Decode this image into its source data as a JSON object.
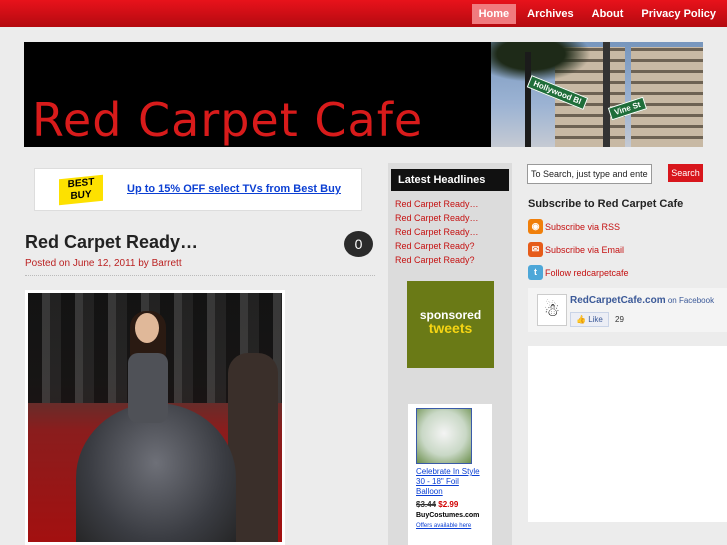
{
  "nav": {
    "items": [
      {
        "label": "Home",
        "active": true
      },
      {
        "label": "Archives",
        "active": false
      },
      {
        "label": "About",
        "active": false
      },
      {
        "label": "Privacy Policy",
        "active": false
      }
    ]
  },
  "header": {
    "site_title": "Red Carpet Cafe",
    "street_sign_1": "Hollywood Bl",
    "street_sign_2": "Vine St"
  },
  "ad": {
    "brand_line1": "BEST",
    "brand_line2": "BUY",
    "link_text": "Up to 15% OFF select TVs from Best Buy"
  },
  "post": {
    "title": "Red Carpet Ready…",
    "comment_count": "0",
    "meta_prefix": "Posted on ",
    "date": "June 12, 2011",
    "meta_by": " by ",
    "author": "Barrett"
  },
  "headlines": {
    "title": "Latest Headlines",
    "items": [
      "Red Carpet Ready…",
      "Red Carpet Ready…",
      "Red Carpet Ready…",
      "Red Carpet Ready?",
      "Red Carpet Ready?"
    ]
  },
  "sponsored": {
    "line1": "sponsored",
    "line2": "tweets"
  },
  "product_ad": {
    "link": "Celebrate In Style 30 - 18\" Foil Balloon",
    "old_price": "$3.44",
    "new_price": "$2.99",
    "store": "BuyCostumes.com",
    "offers": "Offers available here"
  },
  "search": {
    "placeholder": "To Search, just type and ente",
    "button_label": "Search"
  },
  "subscribe": {
    "title": "Subscribe to Red Carpet Cafe",
    "rss": "Subscribe via RSS",
    "email": "Subscribe via Email",
    "twitter": "Follow redcarpetcafe"
  },
  "facebook": {
    "page_name": "RedCarpetCafe.com",
    "suffix": " on Facebook",
    "like_label": "Like",
    "like_count": "29"
  },
  "colors": {
    "brand_red": "#d81b1b",
    "nav_active": "#f07b7f",
    "link_red": "#c51111"
  }
}
